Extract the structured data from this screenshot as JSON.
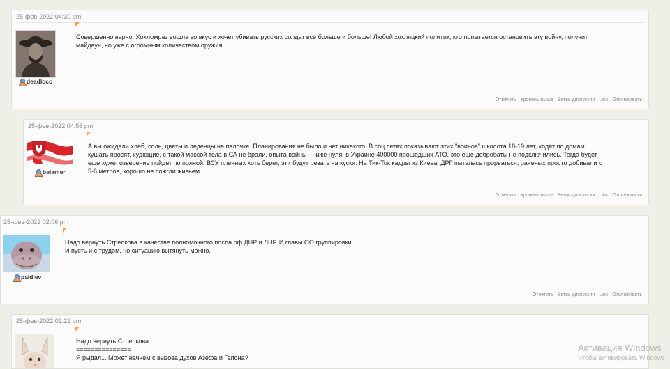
{
  "comments": [
    {
      "date": "25-фев-2022 04:30 pm",
      "username": "deadloco",
      "lines": [
        "Совершенно верно. Хохломраз вошла во вкус и хочет убивать русских солдат все больше и больше! Любой хохляцкий политик, кто попытается остановить эту войну, получит",
        "майдаун, но уже с огромным количеством оружия."
      ],
      "actions": [
        "Ответить",
        "Уровень выше",
        "Ветвь дискуссии",
        "Link",
        "Отслеживать"
      ]
    },
    {
      "date": "25-фев-2022 04:56 pm",
      "username": "belamer",
      "lines": [
        "А вы ожидали хлеб, соль, цветы и леденцы на палочке. Планирования не было и нет никакого. В соц сетях показывают этих \"воинов\" школота 18-19 лет, ходят по домам",
        "кушать просят, худющие, с такой массой тела в СА не брали, опыта войны - ниже нуля, в Украине 400000 прошедших АТО, это еще добробаты не подключились. Тогда будет",
        "еще хуже, озверение пойдет по полной. ВСУ пленных хоть берет, эти будут резать на куски. На Тик-Ток кадры из Киева, ДРГ пыталась прорваться, раненых просто добивали с",
        "5-6 метров, хорошо не сожгли живьем."
      ],
      "actions": [
        "Ответить",
        "Уровень выше",
        "Ветвь дискуссии",
        "Link",
        "Отслеживать"
      ]
    },
    {
      "date": "25-фев-2022 02:06 pm",
      "username": "paidiev",
      "lines": [
        "Надо вернуть Стрелкова в качестве полномочного посла рф ДНР и ЛНР. И главы ОО группировки.",
        "И пусть и с трудом, но ситуацию вытянуть можно."
      ],
      "actions": [
        "Ответить",
        "Ветвь дискуссии",
        "Link",
        "Отслеживать"
      ]
    },
    {
      "date": "25-фев-2022 02:22 pm",
      "username": "",
      "lines": [
        "Надо вернуть Стрелкова...",
        "===============",
        "Я рыдал... Может начнем с вызова духов Азефа и Гапона?"
      ],
      "actions": []
    }
  ],
  "watermark": {
    "title": "Активация Windows",
    "subtitle": "Чтобы активировать Windows"
  },
  "colors": {
    "background": "#efefe8",
    "card": "#fbfbfb",
    "accent_tick": "#f2a04a",
    "muted": "#8a8a8a"
  }
}
